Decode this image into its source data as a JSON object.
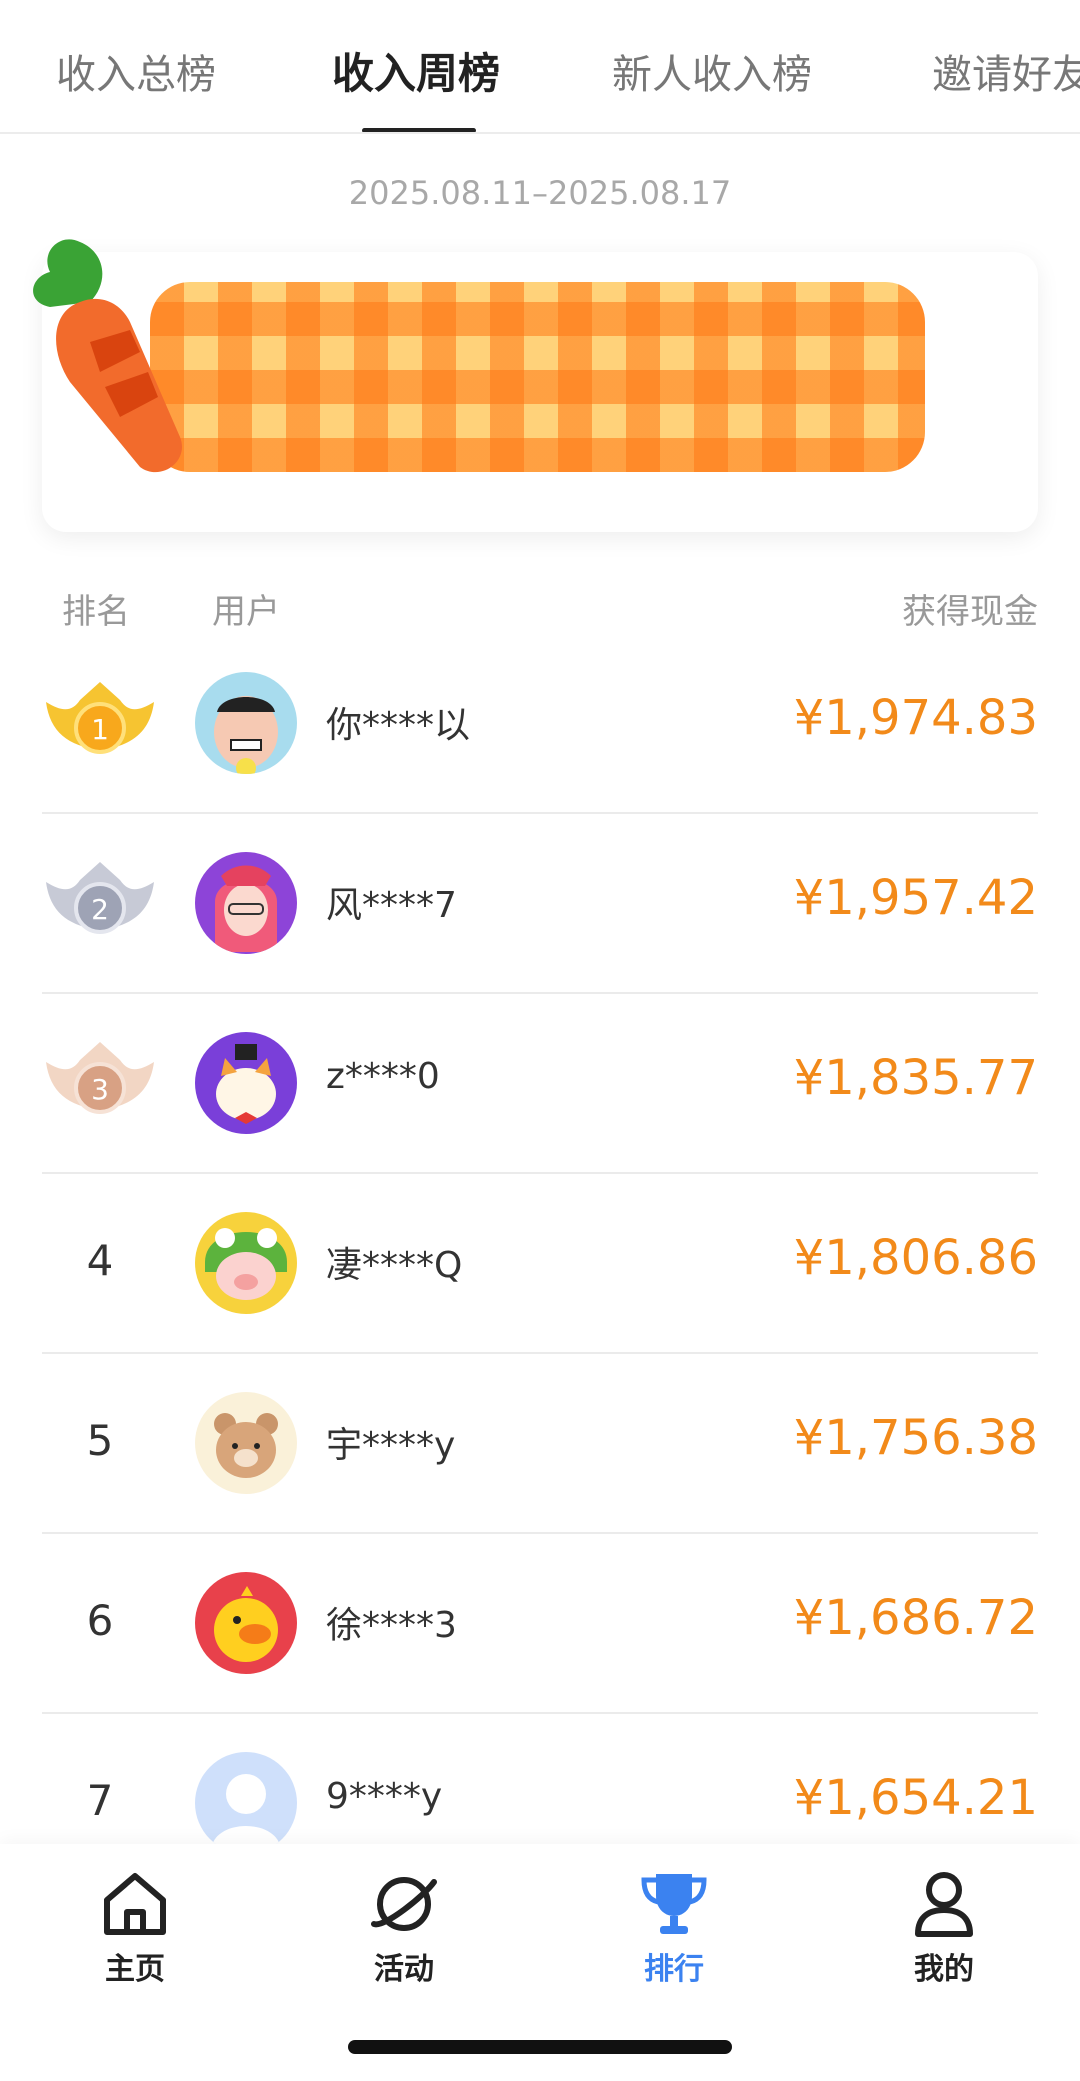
{
  "tabs": [
    {
      "label": "收入总榜"
    },
    {
      "label": "收入周榜"
    },
    {
      "label": "新人收入榜"
    },
    {
      "label": "邀请好友"
    }
  ],
  "date_range": "2025.08.11–2025.08.17",
  "list_header": {
    "rank": "排名",
    "user": "用户",
    "cash": "获得现金"
  },
  "colors": {
    "accent": "#3b82f0",
    "amount": "#f28a1a"
  },
  "rows": [
    {
      "rank": "1",
      "name": "你****以",
      "amount": "¥1,974.83",
      "avatar": "cartoon-man-avatar",
      "medal": "gold-crown-medal"
    },
    {
      "rank": "2",
      "name": "风****7",
      "amount": "¥1,957.42",
      "avatar": "anime-girl-avatar",
      "medal": "silver-crown-medal"
    },
    {
      "rank": "3",
      "name": "z****0",
      "amount": "¥1,835.77",
      "avatar": "cat-avatar",
      "medal": "bronze-crown-medal"
    },
    {
      "rank": "4",
      "name": "凄****Q",
      "amount": "¥1,806.86",
      "avatar": "pig-frog-avatar"
    },
    {
      "rank": "5",
      "name": "宇****y",
      "amount": "¥1,756.38",
      "avatar": "bear-avatar"
    },
    {
      "rank": "6",
      "name": "徐****3",
      "amount": "¥1,686.72",
      "avatar": "duck-avatar"
    },
    {
      "rank": "7",
      "name": "9****y",
      "amount": "¥1,654.21",
      "avatar": "default-avatar"
    }
  ],
  "nav": [
    {
      "label": "主页",
      "icon": "home-icon"
    },
    {
      "label": "活动",
      "icon": "planet-icon"
    },
    {
      "label": "排行",
      "icon": "trophy-icon"
    },
    {
      "label": "我的",
      "icon": "user-icon"
    }
  ]
}
